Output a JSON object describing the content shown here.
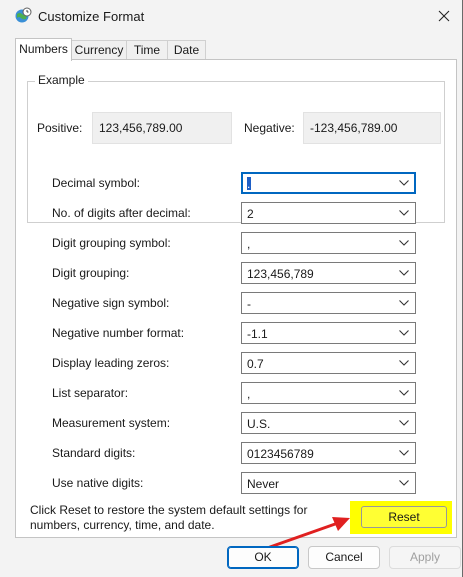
{
  "window": {
    "title": "Customize Format",
    "app_icon": "globe-clock-icon",
    "close_icon": "close-icon"
  },
  "tabs": [
    {
      "label": "Numbers",
      "active": true
    },
    {
      "label": "Currency",
      "active": false
    },
    {
      "label": "Time",
      "active": false
    },
    {
      "label": "Date",
      "active": false
    }
  ],
  "example": {
    "group_label": "Example",
    "positive_label": "Positive:",
    "positive_value": "123,456,789.00",
    "negative_label": "Negative:",
    "negative_value": "-123,456,789.00"
  },
  "settings": [
    {
      "label": "Decimal symbol:",
      "value": "."
    },
    {
      "label": "No. of digits after decimal:",
      "value": "2"
    },
    {
      "label": "Digit grouping symbol:",
      "value": ","
    },
    {
      "label": "Digit grouping:",
      "value": "123,456,789"
    },
    {
      "label": "Negative sign symbol:",
      "value": "-"
    },
    {
      "label": "Negative number format:",
      "value": "-1.1"
    },
    {
      "label": "Display leading zeros:",
      "value": "0.7"
    },
    {
      "label": "List separator:",
      "value": ","
    },
    {
      "label": "Measurement system:",
      "value": "U.S."
    },
    {
      "label": "Standard digits:",
      "value": "0123456789"
    },
    {
      "label": "Use native digits:",
      "value": "Never"
    }
  ],
  "reset": {
    "note_line1": "Click Reset to restore the system default settings for",
    "note_line2": "numbers, currency, time, and date.",
    "button_label": "Reset",
    "highlight_color": "#ffff00",
    "arrow_color": "#e02020"
  },
  "footer": {
    "ok_label": "OK",
    "cancel_label": "Cancel",
    "apply_label": "Apply"
  }
}
